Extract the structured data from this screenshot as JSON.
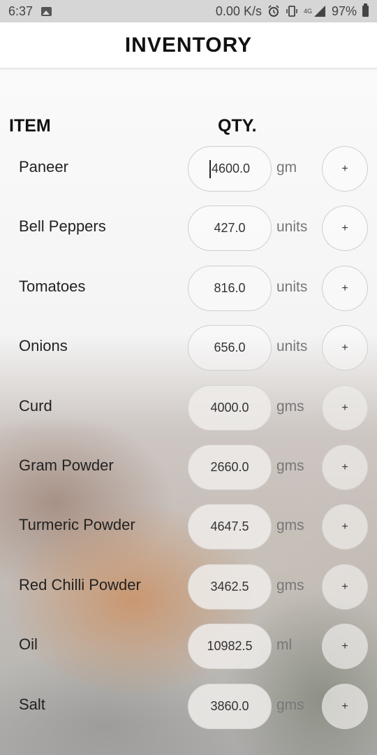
{
  "status_bar": {
    "time": "6:37",
    "net_speed": "0.00 K/s",
    "network_label": "4G",
    "battery": "97%"
  },
  "app_bar": {
    "title": "INVENTORY"
  },
  "headers": {
    "item": "ITEM",
    "qty": "QTY."
  },
  "rows": [
    {
      "name": "Paneer",
      "qty": "4600.0",
      "unit": "gm",
      "add_label": "+"
    },
    {
      "name": "Bell Peppers",
      "qty": "427.0",
      "unit": "units",
      "add_label": "+"
    },
    {
      "name": "Tomatoes",
      "qty": "816.0",
      "unit": "units",
      "add_label": "+"
    },
    {
      "name": "Onions",
      "qty": "656.0",
      "unit": "units",
      "add_label": "+"
    },
    {
      "name": "Curd",
      "qty": "4000.0",
      "unit": "gms",
      "add_label": "+"
    },
    {
      "name": "Gram Powder",
      "qty": "2660.0",
      "unit": "gms",
      "add_label": "+"
    },
    {
      "name": "Turmeric Powder",
      "qty": "4647.5",
      "unit": "gms",
      "add_label": "+"
    },
    {
      "name": "Red Chilli Powder",
      "qty": "3462.5",
      "unit": "gms",
      "add_label": "+"
    },
    {
      "name": "Oil",
      "qty": "10982.5",
      "unit": "ml",
      "add_label": "+"
    },
    {
      "name": "Salt",
      "qty": "3860.0",
      "unit": "gms",
      "add_label": "+"
    }
  ],
  "icons": {
    "image": "image-icon",
    "alarm": "alarm-icon",
    "vibrate": "vibrate-icon",
    "signal": "signal-icon",
    "battery": "battery-icon"
  }
}
